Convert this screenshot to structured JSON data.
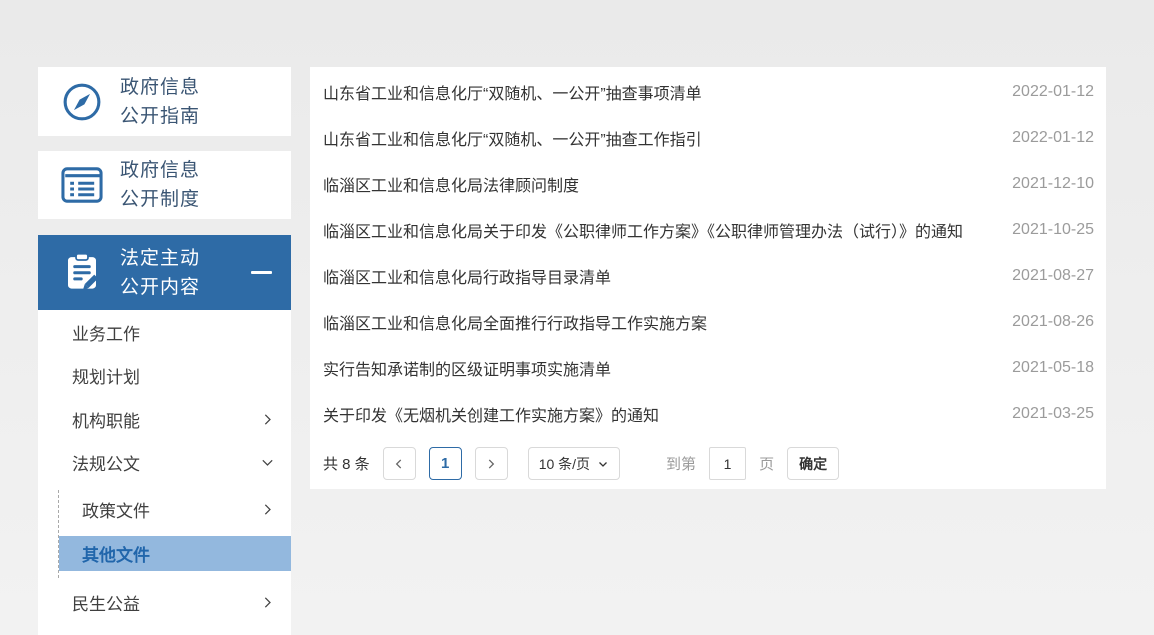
{
  "colors": {
    "accent_blue": "#2e6ba6",
    "active_card_bg": "#2e6ba6",
    "submenu_highlight_bg": "#93b8de",
    "submenu_highlight_text": "#2166ab",
    "sidebar_text": "#3a5573",
    "list_title_text": "#333333",
    "date_text": "#9b9b9b",
    "page_background": "#eeeeee"
  },
  "sidebar": {
    "cards": [
      {
        "line1": "政府信息",
        "line2": "公开指南",
        "icon": "compass-icon"
      },
      {
        "line1": "政府信息",
        "line2": "公开制度",
        "icon": "ledger-icon"
      },
      {
        "line1": "法定主动",
        "line2": "公开内容",
        "icon": "clipboard-pen-icon",
        "collapse_icon": "minus-icon"
      }
    ],
    "menu": [
      {
        "label": "业务工作"
      },
      {
        "label": "规划计划"
      },
      {
        "label": "机构职能",
        "chevron": "right"
      },
      {
        "label": "法规公文",
        "chevron": "down"
      },
      {
        "label": "政策文件",
        "chevron": "right",
        "level": 2
      },
      {
        "label": "其他文件",
        "level": 2,
        "active": true
      },
      {
        "label": "民生公益",
        "chevron": "right"
      }
    ]
  },
  "main": {
    "list": [
      {
        "title": "山东省工业和信息化厅“双随机、一公开”抽查事项清单",
        "date": "2022-01-12"
      },
      {
        "title": "山东省工业和信息化厅“双随机、一公开”抽查工作指引",
        "date": "2022-01-12"
      },
      {
        "title": "临淄区工业和信息化局法律顾问制度",
        "date": "2021-12-10"
      },
      {
        "title": "临淄区工业和信息化局关于印发《公职律师工作方案》《公职律师管理办法（试行）》的通知",
        "date": "2021-10-25"
      },
      {
        "title": "临淄区工业和信息化局行政指导目录清单",
        "date": "2021-08-27"
      },
      {
        "title": "临淄区工业和信息化局全面推行行政指导工作实施方案",
        "date": "2021-08-26"
      },
      {
        "title": "实行告知承诺制的区级证明事项实施清单",
        "date": "2021-05-18"
      },
      {
        "title": "关于印发《无烟机关创建工作实施方案》的通知",
        "date": "2021-03-25"
      }
    ],
    "pagination": {
      "total": "共 8 条",
      "current_page": "1",
      "page_size": "10 条/页",
      "goto_prefix": "到第",
      "goto_value": "1",
      "goto_suffix": "页",
      "confirm": "确定"
    }
  }
}
